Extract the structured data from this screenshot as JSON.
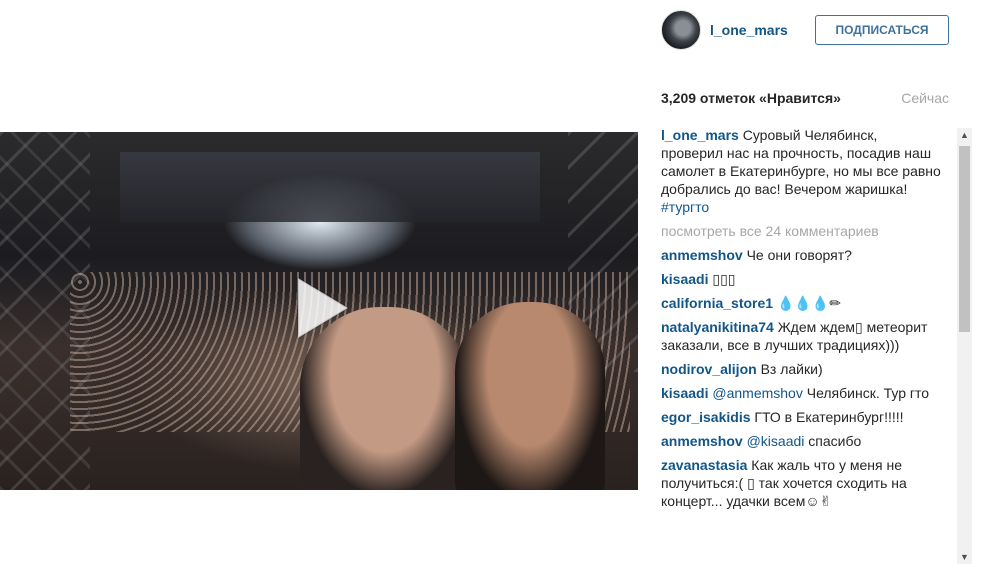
{
  "post": {
    "username": "l_one_mars",
    "follow_label": "ПОДПИСАТЬСЯ",
    "likes": "3,209 отметок «Нравится»",
    "time": "Сейчас"
  },
  "caption": {
    "user": "l_one_mars",
    "text": " Суровый Челябинск, проверил нас на прочность, посадив наш самолет в Екатеринбурге, но мы все равно добрались до вас! Вечером жаришка! ",
    "hashtag": "#тургто"
  },
  "view_all": "посмотреть все 24 комментариев",
  "comments": [
    {
      "user": "anmemshov",
      "mention": "",
      "text": "Че они говорят?"
    },
    {
      "user": "kisaadi",
      "mention": "",
      "text": "▯▯▯"
    },
    {
      "user": "california_store1",
      "mention": "",
      "text": "💧💧💧✏"
    },
    {
      "user": "natalyanikitina74",
      "mention": "",
      "text": "Ждем ждем▯ метеорит заказали, все в лучших традициях)))"
    },
    {
      "user": "nodirov_alijon",
      "mention": "",
      "text": "Вз лайки)"
    },
    {
      "user": "kisaadi",
      "mention": "@anmemshov",
      "text": "Челябинск. Тур гто"
    },
    {
      "user": "egor_isakidis",
      "mention": "",
      "text": "ГТО в Екатеринбург!!!!!"
    },
    {
      "user": "anmemshov",
      "mention": "@kisaadi",
      "text": "спасибо"
    },
    {
      "user": "zavanastasia",
      "mention": "",
      "text": "Как жаль что у меня не получиться:( ▯ так хочется сходить на концерт... удачки всем☺✌"
    }
  ],
  "icons": {
    "play": "play-icon",
    "avatar": "avatar",
    "scroll_up": "arrow-up-icon",
    "scroll_down": "arrow-down-icon"
  },
  "colors": {
    "link": "#125688",
    "follow_border": "#3f729b",
    "muted": "#a5a7aa"
  }
}
